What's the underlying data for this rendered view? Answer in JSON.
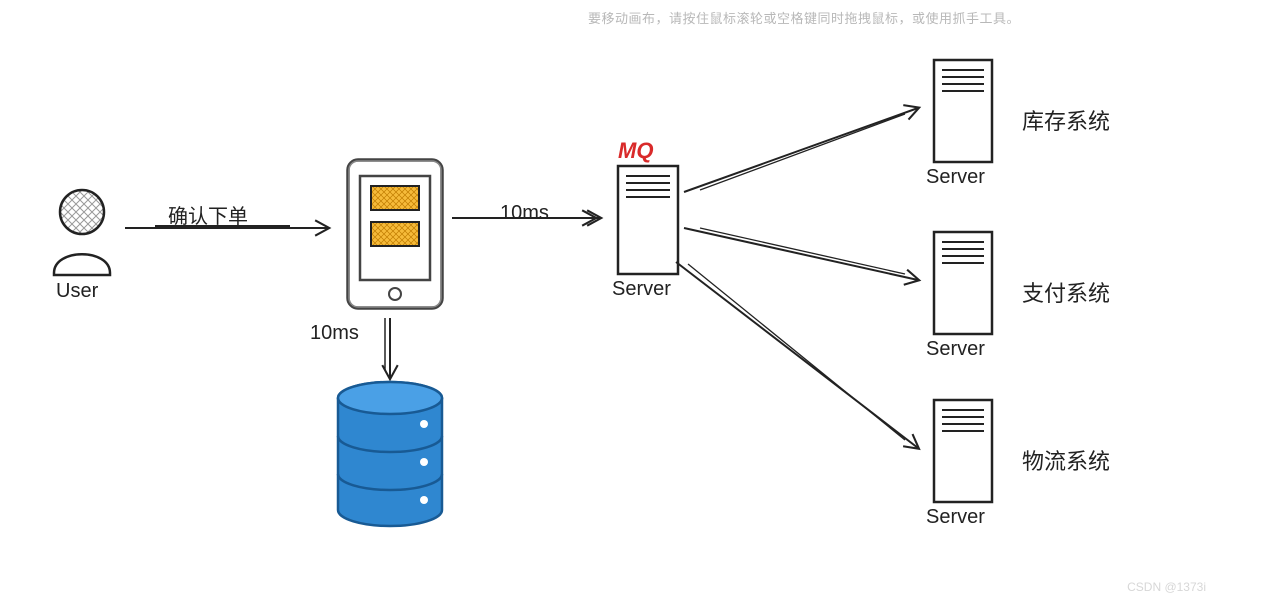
{
  "hint": "要移动画布，请按住鼠标滚轮或空格键同时拖拽鼠标，或使用抓手工具。",
  "user_label": "User",
  "confirm_order_label": "确认下单",
  "latency_to_mq": "10ms",
  "latency_to_db": "10ms",
  "mq_label": "MQ",
  "mq_server_label": "Server",
  "servers": {
    "inventory": {
      "label": "Server",
      "system": "库存系统"
    },
    "payment": {
      "label": "Server",
      "system": "支付系统"
    },
    "logistics": {
      "label": "Server",
      "system": "物流系统"
    }
  },
  "watermark": "CSDN @1373i"
}
